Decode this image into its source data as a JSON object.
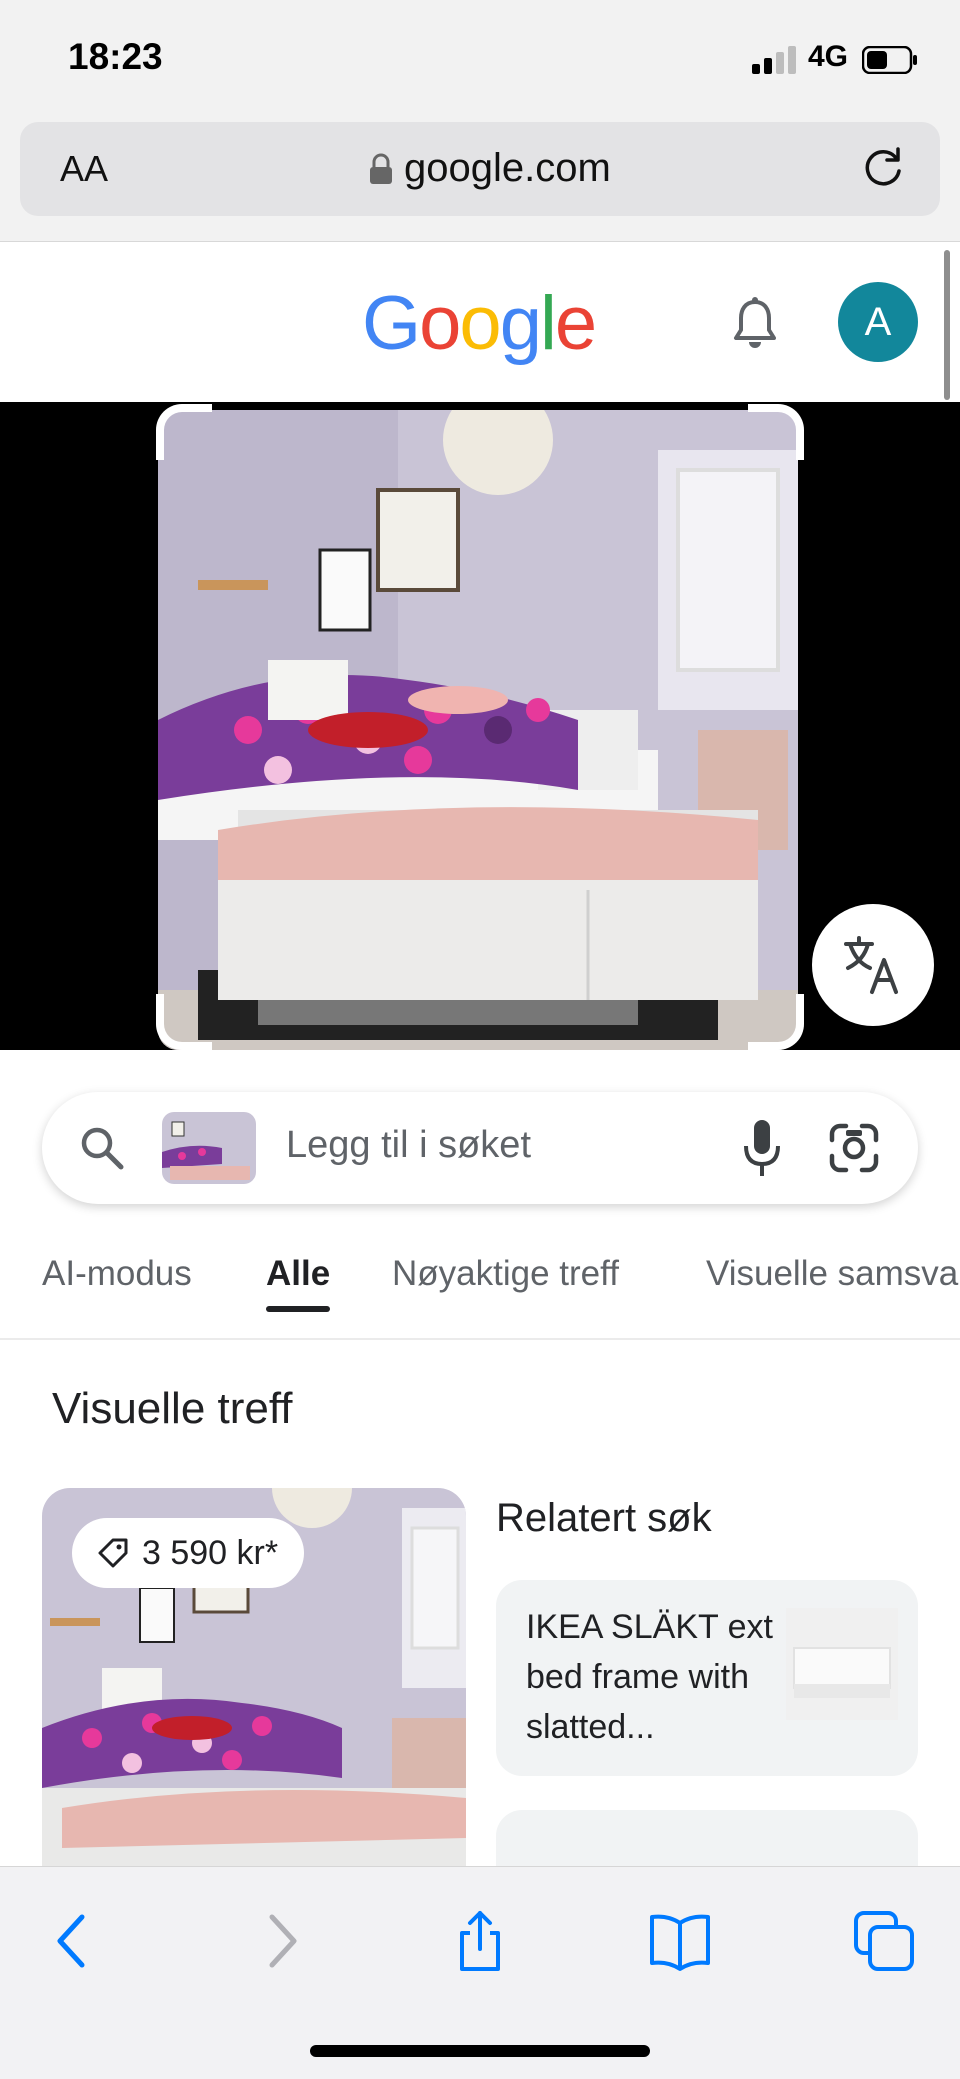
{
  "status_bar": {
    "time": "18:23",
    "network": "4G"
  },
  "address_bar": {
    "text_size_label": "AA",
    "url": "google.com"
  },
  "google": {
    "logo": "Google",
    "avatar_letter": "A"
  },
  "search": {
    "placeholder": "Legg til i søket"
  },
  "tabs": [
    {
      "label": "AI-modus",
      "active": false
    },
    {
      "label": "Alle",
      "active": true
    },
    {
      "label": "Nøyaktige treff",
      "active": false
    },
    {
      "label": "Visuelle samsva",
      "active": false
    }
  ],
  "results": {
    "section_title": "Visuelle treff",
    "card": {
      "price": "3 590 kr*"
    },
    "related": {
      "title": "Relatert søk",
      "items": [
        {
          "label": "IKEA SLÄKT ext bed frame with slatted..."
        }
      ]
    }
  },
  "icons": {
    "signal": "signal-bars-icon",
    "battery": "battery-icon",
    "lock": "lock-icon",
    "reload": "reload-icon",
    "bell": "bell-icon",
    "translate": "translate-icon",
    "search": "search-icon",
    "mic": "mic-icon",
    "lens": "google-lens-icon",
    "tag": "price-tag-icon",
    "back": "back-chevron-icon",
    "forward": "forward-chevron-icon",
    "share": "share-icon",
    "bookmarks": "bookmarks-icon",
    "tabs": "tabs-icon"
  },
  "colors": {
    "accent_blue": "#1a73e8",
    "avatar_bg": "#12879b",
    "safari_blue": "#007aff"
  }
}
